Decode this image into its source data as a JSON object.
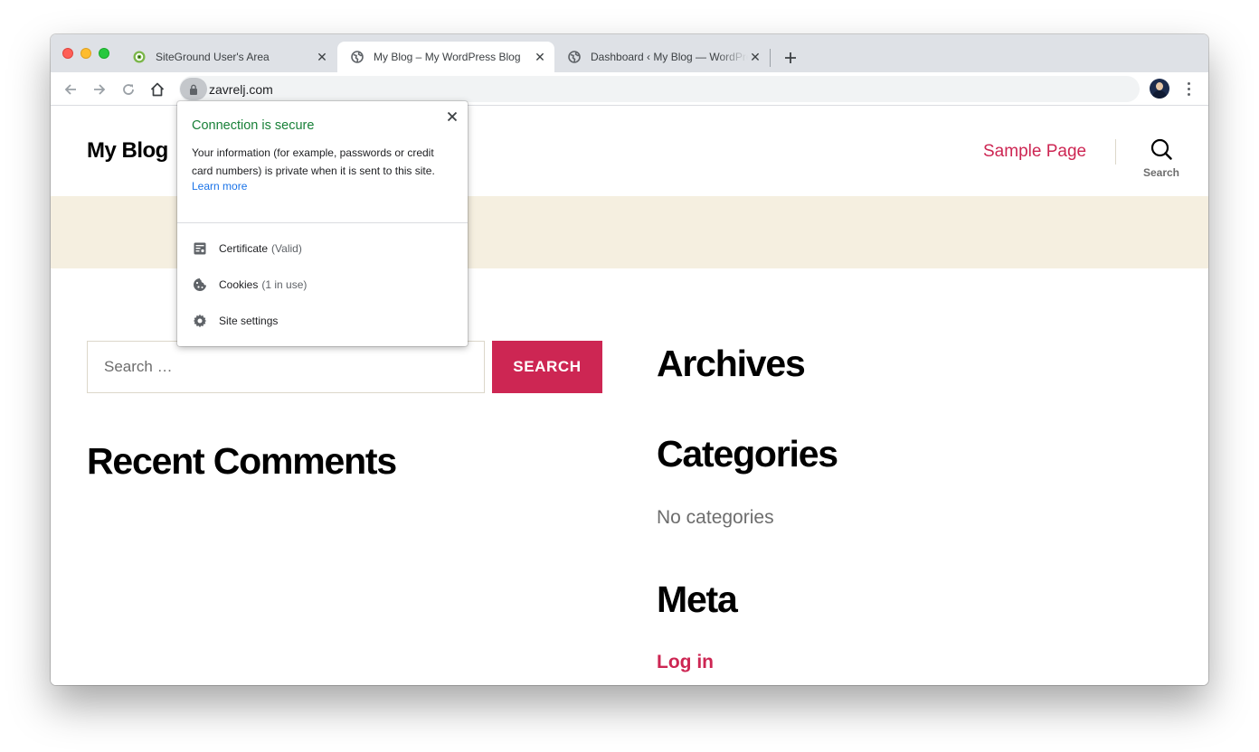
{
  "browser": {
    "tabs": [
      {
        "title": "SiteGround User's Area",
        "icon": "siteground-favicon",
        "active": false
      },
      {
        "title": "My Blog – My WordPress Blog",
        "icon": "globe-icon",
        "active": true
      },
      {
        "title": "Dashboard ‹ My Blog — WordPress",
        "icon": "globe-icon",
        "active": false
      }
    ],
    "url": "zavrelj.com"
  },
  "site": {
    "title": "My Blog",
    "nav_link": "Sample Page",
    "search_toggle_label": "Search"
  },
  "search_widget": {
    "placeholder": "Search …",
    "button_label": "SEARCH"
  },
  "widgets": {
    "recent_comments_title": "Recent Comments",
    "archives_title": "Archives",
    "categories_title": "Categories",
    "categories_empty": "No categories",
    "meta_title": "Meta",
    "meta_login": "Log in"
  },
  "site_info_popup": {
    "title": "Connection is secure",
    "description": "Your information (for example, passwords or credit card numbers) is private when it is sent to this site.",
    "learn_more": "Learn more",
    "certificate_label": "Certificate",
    "certificate_status": "(Valid)",
    "cookies_label": "Cookies",
    "cookies_status": "(1 in use)",
    "site_settings_label": "Site settings"
  },
  "colors": {
    "accent": "#cd2653",
    "secure_green": "#188038",
    "link_blue": "#1a73e8",
    "header_band": "#f5efe0"
  }
}
